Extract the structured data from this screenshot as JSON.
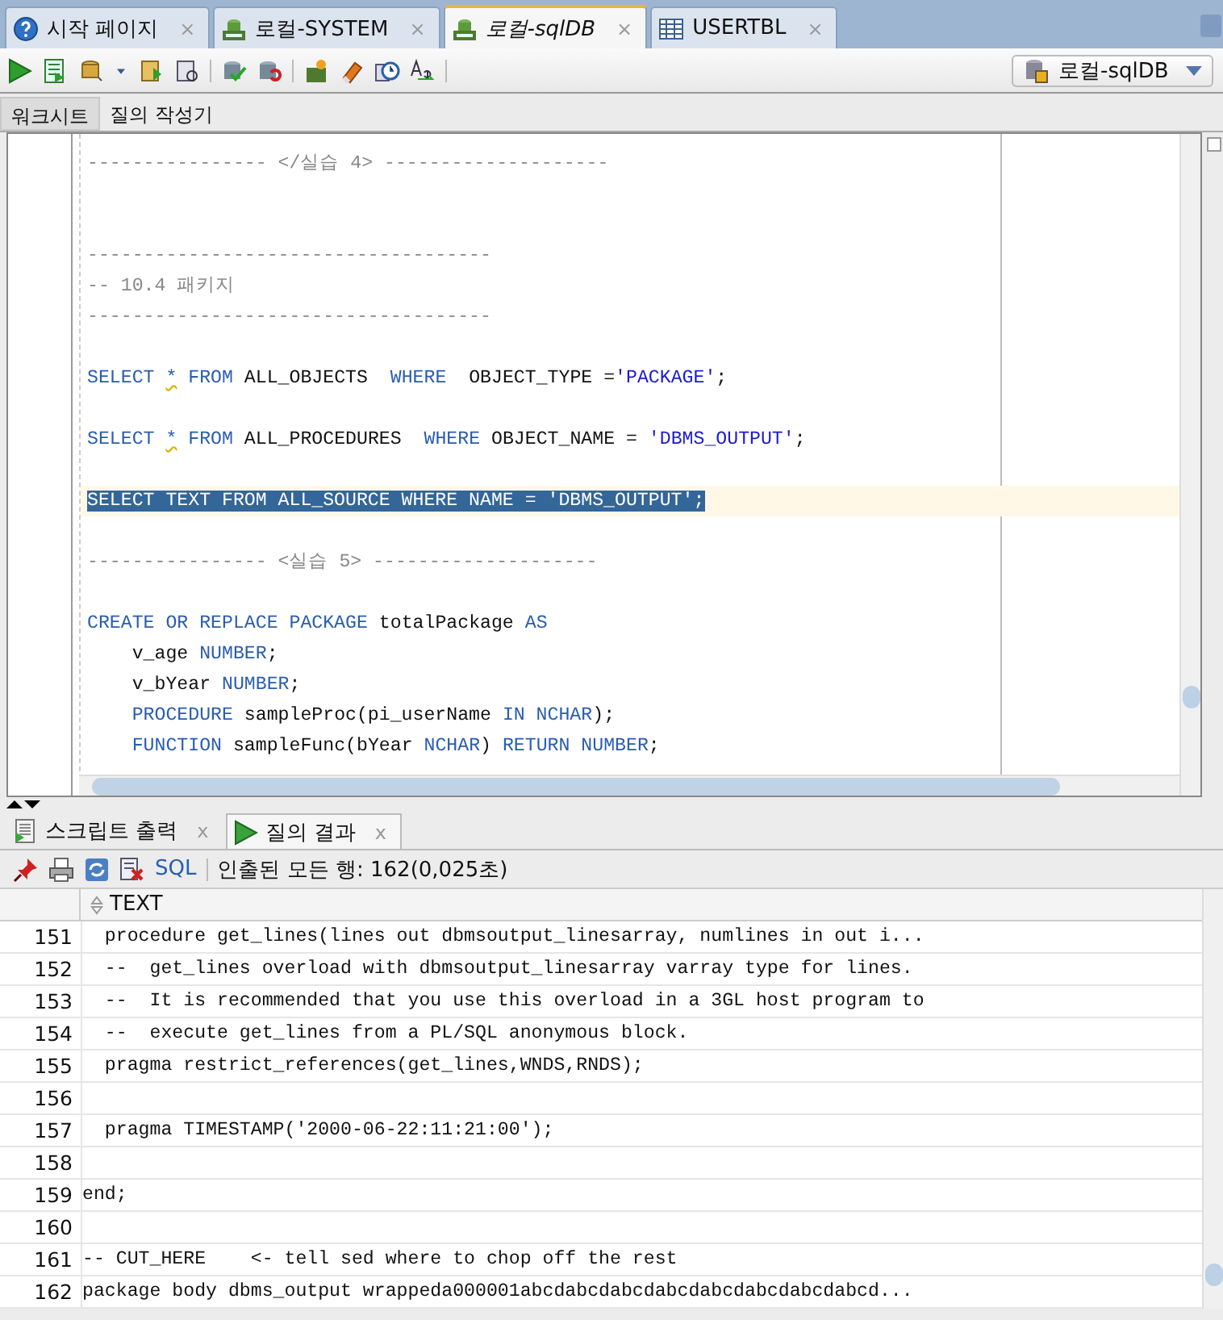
{
  "tabs": [
    {
      "label": "시작 페이지",
      "kind": "help",
      "close": "×",
      "selected": false
    },
    {
      "label": "로컬-SYSTEM",
      "kind": "sql",
      "close": "×",
      "selected": false
    },
    {
      "label": "로컬-sqlDB",
      "kind": "sql",
      "close": "×",
      "selected": true
    },
    {
      "label": "USERTBL",
      "kind": "table",
      "close": "×",
      "selected": false
    }
  ],
  "connection": "로컬-sqlDB",
  "editor_tabs": [
    {
      "label": "워크시트",
      "selected": true
    },
    {
      "label": "질의 작성기",
      "selected": false
    }
  ],
  "editor_lines": [
    {
      "selected": false,
      "tokens": [
        {
          "text": "---------------- </실습 4> --------------------",
          "kind": "comment"
        }
      ]
    },
    {
      "selected": false
    },
    {
      "selected": false
    },
    {
      "selected": false,
      "tokens": [
        {
          "text": "------------------------------------",
          "kind": "comment"
        }
      ]
    },
    {
      "selected": false,
      "tokens": [
        {
          "text": "-- 10.4 패키지",
          "kind": "comment"
        }
      ]
    },
    {
      "selected": false,
      "tokens": [
        {
          "text": "------------------------------------",
          "kind": "comment"
        }
      ]
    },
    {
      "selected": false
    },
    {
      "selected": false,
      "tokens": [
        {
          "text": "SELECT ",
          "kind": "keyword"
        },
        {
          "text": "*",
          "kind": "warning"
        },
        {
          "text": " FROM ",
          "kind": "keyword"
        },
        {
          "text": "ALL_OBJECTS  ",
          "kind": "plain"
        },
        {
          "text": "WHERE  ",
          "kind": "keyword"
        },
        {
          "text": "OBJECT_TYPE =",
          "kind": "plain"
        },
        {
          "text": "'PACKAGE'",
          "kind": "string"
        },
        {
          "text": ";",
          "kind": "plain"
        }
      ]
    },
    {
      "selected": false
    },
    {
      "selected": false,
      "tokens": [
        {
          "text": "SELECT ",
          "kind": "keyword"
        },
        {
          "text": "*",
          "kind": "warning"
        },
        {
          "text": " FROM ",
          "kind": "keyword"
        },
        {
          "text": "ALL_PROCEDURES  ",
          "kind": "plain"
        },
        {
          "text": "WHERE ",
          "kind": "keyword"
        },
        {
          "text": "OBJECT_NAME = ",
          "kind": "plain"
        },
        {
          "text": "'DBMS_OUTPUT'",
          "kind": "string"
        },
        {
          "text": ";",
          "kind": "plain"
        }
      ]
    },
    {
      "selected": false
    },
    {
      "selected": true,
      "tokens": [
        {
          "text": "SELECT TEXT FROM ALL_SOURCE WHERE NAME = 'DBMS_OUTPUT';",
          "kind": "plain"
        }
      ]
    },
    {
      "selected": false
    },
    {
      "selected": false,
      "tokens": [
        {
          "text": "---------------- <실습 5> --------------------",
          "kind": "comment"
        }
      ]
    },
    {
      "selected": false
    },
    {
      "selected": false,
      "tokens": [
        {
          "text": "CREATE OR REPLACE PACKAGE ",
          "kind": "keyword"
        },
        {
          "text": "totalPackage ",
          "kind": "plain"
        },
        {
          "text": "AS",
          "kind": "keyword"
        }
      ]
    },
    {
      "selected": false,
      "tokens": [
        {
          "text": "    v_age ",
          "kind": "plain"
        },
        {
          "text": "NUMBER",
          "kind": "keyword"
        },
        {
          "text": ";",
          "kind": "plain"
        }
      ]
    },
    {
      "selected": false,
      "tokens": [
        {
          "text": "    v_bYear ",
          "kind": "plain"
        },
        {
          "text": "NUMBER",
          "kind": "keyword"
        },
        {
          "text": ";",
          "kind": "plain"
        }
      ]
    },
    {
      "selected": false,
      "tokens": [
        {
          "text": "    PROCEDURE ",
          "kind": "keyword"
        },
        {
          "text": "sampleProc(pi_userName ",
          "kind": "plain"
        },
        {
          "text": "IN NCHAR",
          "kind": "keyword"
        },
        {
          "text": ");",
          "kind": "plain"
        }
      ]
    },
    {
      "selected": false,
      "tokens": [
        {
          "text": "    FUNCTION ",
          "kind": "keyword"
        },
        {
          "text": "sampleFunc(bYear ",
          "kind": "plain"
        },
        {
          "text": "NCHAR",
          "kind": "keyword"
        },
        {
          "text": ") ",
          "kind": "plain"
        },
        {
          "text": "RETURN NUMBER",
          "kind": "keyword"
        },
        {
          "text": ";",
          "kind": "plain"
        }
      ]
    }
  ],
  "result_tabs": [
    {
      "label": "스크립트 출력",
      "kind": "script",
      "close": "x",
      "selected": false
    },
    {
      "label": "질의 결과",
      "kind": "run",
      "close": "x",
      "selected": true
    }
  ],
  "result_toolbar": {
    "sql_link": "SQL",
    "status": "인출된 모든 행: 162(0,025초)"
  },
  "table": {
    "columns": [
      "TEXT"
    ],
    "rows": [
      {
        "number": "151",
        "text": "  procedure get_lines(lines out dbmsoutput_linesarray, numlines in out i..."
      },
      {
        "number": "152",
        "text": "  --  get_lines overload with dbmsoutput_linesarray varray type for lines."
      },
      {
        "number": "153",
        "text": "  --  It is recommended that you use this overload in a 3GL host program to"
      },
      {
        "number": "154",
        "text": "  --  execute get_lines from a PL/SQL anonymous block."
      },
      {
        "number": "155",
        "text": "  pragma restrict_references(get_lines,WNDS,RNDS);"
      },
      {
        "number": "156",
        "text": ""
      },
      {
        "number": "157",
        "text": "  pragma TIMESTAMP('2000-06-22:11:21:00');"
      },
      {
        "number": "158",
        "text": ""
      },
      {
        "number": "159",
        "text": "end;"
      },
      {
        "number": "160",
        "text": ""
      },
      {
        "number": "161",
        "text": "-- CUT_HERE    <- tell sed where to chop off the rest"
      },
      {
        "number": "162",
        "text": "package body dbms_output wrappeda000001abcdabcdabcdabcdabcdabcdabcdabcd..."
      }
    ]
  }
}
